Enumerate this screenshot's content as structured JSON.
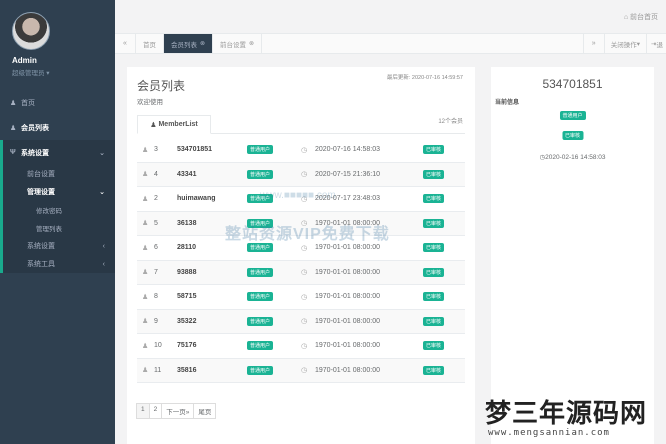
{
  "sidebar": {
    "profile": {
      "name": "Admin",
      "role": "超级管理员 ▾"
    },
    "items": [
      {
        "label": "首页"
      },
      {
        "label": "会员列表"
      },
      {
        "label": "系统设置"
      }
    ],
    "system_sub": [
      {
        "label": "前台设置"
      },
      {
        "label": "管理设置"
      }
    ],
    "manage_sub": [
      {
        "label": "修改密码"
      },
      {
        "label": "管理列表"
      }
    ],
    "bottom_items": [
      {
        "label": "系统设置"
      },
      {
        "label": "系统工具"
      }
    ]
  },
  "topbar": {
    "front_link": "前台首页"
  },
  "tabs": {
    "home": "首页",
    "member": "会员列表",
    "front": "前台设置",
    "ops": "关闭操作",
    "exit": "退"
  },
  "main": {
    "title": "会员列表",
    "subtitle": "欢迎使用",
    "last_update": "最后更新: 2020-07-16 14:59:57",
    "tab_label": "MemberList",
    "count": "12个会员",
    "rows": [
      {
        "id": "3",
        "name": "534701851",
        "badge": "普通用户",
        "time": "2020-07-16 14:58:03",
        "status": "已审核"
      },
      {
        "id": "4",
        "name": "43341",
        "badge": "普通用户",
        "time": "2020-07-15 21:36:10",
        "status": "已审核"
      },
      {
        "id": "2",
        "name": "huimawang",
        "badge": "普通用户",
        "time": "2020-07-17 23:48:03",
        "status": "已审核"
      },
      {
        "id": "5",
        "name": "36138",
        "badge": "普通用户",
        "time": "1970-01-01 08:00:00",
        "status": "已审核"
      },
      {
        "id": "6",
        "name": "28110",
        "badge": "普通用户",
        "time": "1970-01-01 08:00:00",
        "status": "已审核"
      },
      {
        "id": "7",
        "name": "93888",
        "badge": "普通用户",
        "time": "1970-01-01 08:00:00",
        "status": "已审核"
      },
      {
        "id": "8",
        "name": "58715",
        "badge": "普通用户",
        "time": "1970-01-01 08:00:00",
        "status": "已审核"
      },
      {
        "id": "9",
        "name": "35322",
        "badge": "普通用户",
        "time": "1970-01-01 08:00:00",
        "status": "已审核"
      },
      {
        "id": "10",
        "name": "75176",
        "badge": "普通用户",
        "time": "1970-01-01 08:00:00",
        "status": "已审核"
      },
      {
        "id": "11",
        "name": "35816",
        "badge": "普通用户",
        "time": "1970-01-01 08:00:00",
        "status": "已审核"
      }
    ],
    "pager": {
      "p1": "1",
      "p2": "2",
      "next": "下一页»",
      "last": "尾页"
    }
  },
  "side": {
    "number": "534701851",
    "label": "当前信息",
    "badge": "普通用户",
    "status": "已审核",
    "time": "2020-02-16 14:58:03"
  },
  "watermark": {
    "text": "整站资源VIP免费下载",
    "site": "www.■■■■■.com",
    "logo": "梦三年源码网",
    "logo_url": "www.mengsannian.com"
  },
  "colors": {
    "sidebar": "#2f4050",
    "accent": "#1ab394",
    "background": "#f3f3f4"
  }
}
